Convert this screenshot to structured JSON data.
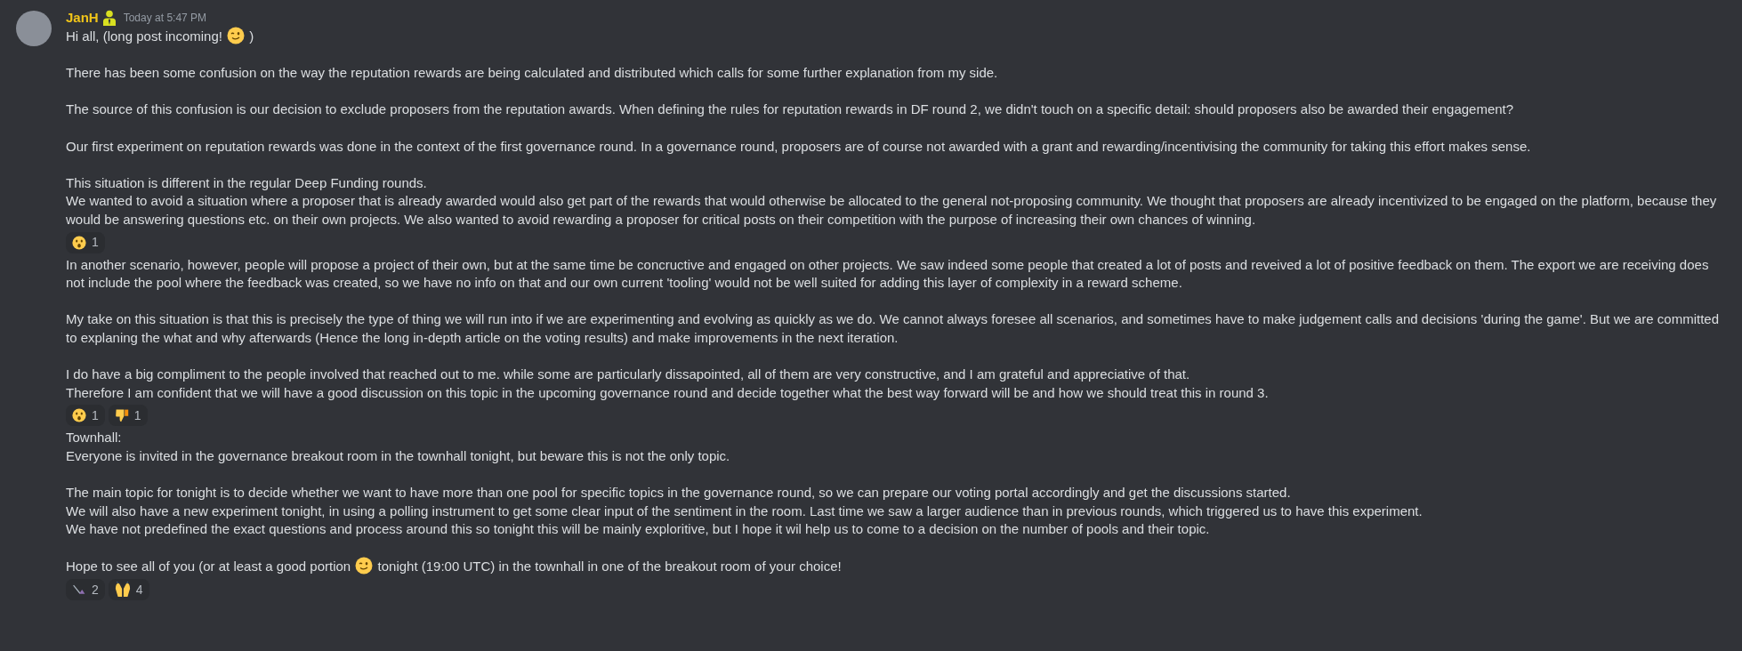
{
  "message": {
    "author": "JanH",
    "timestamp": "Today at 5:47 PM",
    "blocks": [
      {
        "kind": "text",
        "lines": [
          [
            {
              "kind": "text",
              "text": "Hi all, (long post incoming! "
            },
            {
              "kind": "emoji"
            },
            {
              "kind": "text",
              "text": " )"
            }
          ]
        ]
      },
      {
        "kind": "text",
        "lines": [
          [
            {
              "kind": "text",
              "text": "There has been some confusion on the way the reputation rewards are being calculated and distributed which calls for some further explanation from my side."
            }
          ]
        ]
      },
      {
        "kind": "text",
        "lines": [
          [
            {
              "kind": "text",
              "text": "The source of this confusion is our decision to exclude proposers from the reputation awards. When defining the rules for reputation rewards in DF round 2, we didn't touch on a specific detail: should proposers also be awarded their engagement?"
            }
          ]
        ]
      },
      {
        "kind": "text",
        "lines": [
          [
            {
              "kind": "text",
              "text": "Our first experiment on reputation rewards was done in the context of the first governance round. In a governance round, proposers are of course not awarded with a grant and rewarding/incentivising the community for taking this effort makes sense."
            }
          ]
        ]
      },
      {
        "kind": "text",
        "lines": [
          [
            {
              "kind": "text",
              "text": "This situation is different in the regular Deep Funding rounds."
            }
          ],
          [
            {
              "kind": "text",
              "text": "We wanted to avoid a situation where a proposer that is already awarded would also get part of the rewards that would otherwise be allocated to the general not-proposing community. We thought that proposers are already incentivized to be engaged on the platform, because they would be answering questions etc. on their own projects. We also wanted to avoid rewarding a proposer for critical posts on their competition with the purpose of increasing their own chances of winning."
            }
          ]
        ]
      },
      {
        "kind": "reactions",
        "items": [
          {
            "kind": "astonished",
            "count": "1"
          }
        ]
      },
      {
        "kind": "text",
        "lines": [
          [
            {
              "kind": "text",
              "text": "In another scenario, however, people will propose a project of their own, but at the same time be concructive and engaged on other projects. We saw indeed some people that created a lot of posts and reveived a lot of positive feedback on them. The export we are receiving does not include the pool where the feedback was created, so we have no info on that and our own current 'tooling' would not be well suited for adding this layer of complexity in a reward scheme."
            }
          ]
        ]
      },
      {
        "kind": "text",
        "lines": [
          [
            {
              "kind": "text",
              "text": "My take on this situation is that this is precisely the type of thing we will run into if we are experimenting and evolving as quickly as we do. We cannot always foresee all scenarios, and sometimes have to make judgement calls and decisions 'during the game'. But we are committed to explaning the what and why afterwards (Hence the long in-depth article on the voting results) and make improvements in the next iteration."
            }
          ]
        ]
      },
      {
        "kind": "text",
        "lines": [
          [
            {
              "kind": "text",
              "text": "I do have a big compliment to the people involved that reached out to me. while some are particularly dissapointed, all of them are very constructive, and I am grateful and appreciative of that."
            }
          ],
          [
            {
              "kind": "text",
              "text": "Therefore I am confident that we will have a good discussion on this topic in the upcoming governance round and decide together what the best way forward will be and how we should treat this in round 3."
            }
          ]
        ]
      },
      {
        "kind": "reactions",
        "items": [
          {
            "kind": "astonished",
            "count": "1"
          },
          {
            "kind": "thumbsdown",
            "count": "1"
          }
        ]
      },
      {
        "kind": "text",
        "lines": [
          [
            {
              "kind": "text",
              "text": "Townhall:"
            }
          ],
          [
            {
              "kind": "text",
              "text": "Everyone is invited in the governance breakout room in the townhall tonight, but beware this is not the only topic."
            }
          ]
        ]
      },
      {
        "kind": "text",
        "lines": [
          [
            {
              "kind": "text",
              "text": "The main topic for tonight is to decide whether we want to have more than one pool for specific topics in the governance round, so we can prepare our voting portal accordingly and get the discussions started."
            }
          ],
          [
            {
              "kind": "text",
              "text": "We will also have a new experiment tonight, in using a polling instrument to get some clear input of the sentiment in the room. Last time we saw a larger audience than in previous rounds, which triggered us to have this experiment."
            }
          ],
          [
            {
              "kind": "text",
              "text": "We have not predefined the exact questions and process around this so tonight this will be mainly exploritive, but I hope it wil help us to come to a decision on the number of pools and their topic."
            }
          ]
        ]
      },
      {
        "kind": "text",
        "lines": [
          [
            {
              "kind": "text",
              "text": "Hope to see all of you (or at least a good portion "
            },
            {
              "kind": "emoji"
            },
            {
              "kind": "text",
              "text": " tonight (19:00 UTC) in the townhall in one of the breakout room of your choice!"
            }
          ]
        ]
      },
      {
        "kind": "reactions",
        "items": [
          {
            "kind": "custom",
            "count": "2"
          },
          {
            "kind": "raisedhands",
            "count": "4"
          }
        ]
      }
    ]
  }
}
